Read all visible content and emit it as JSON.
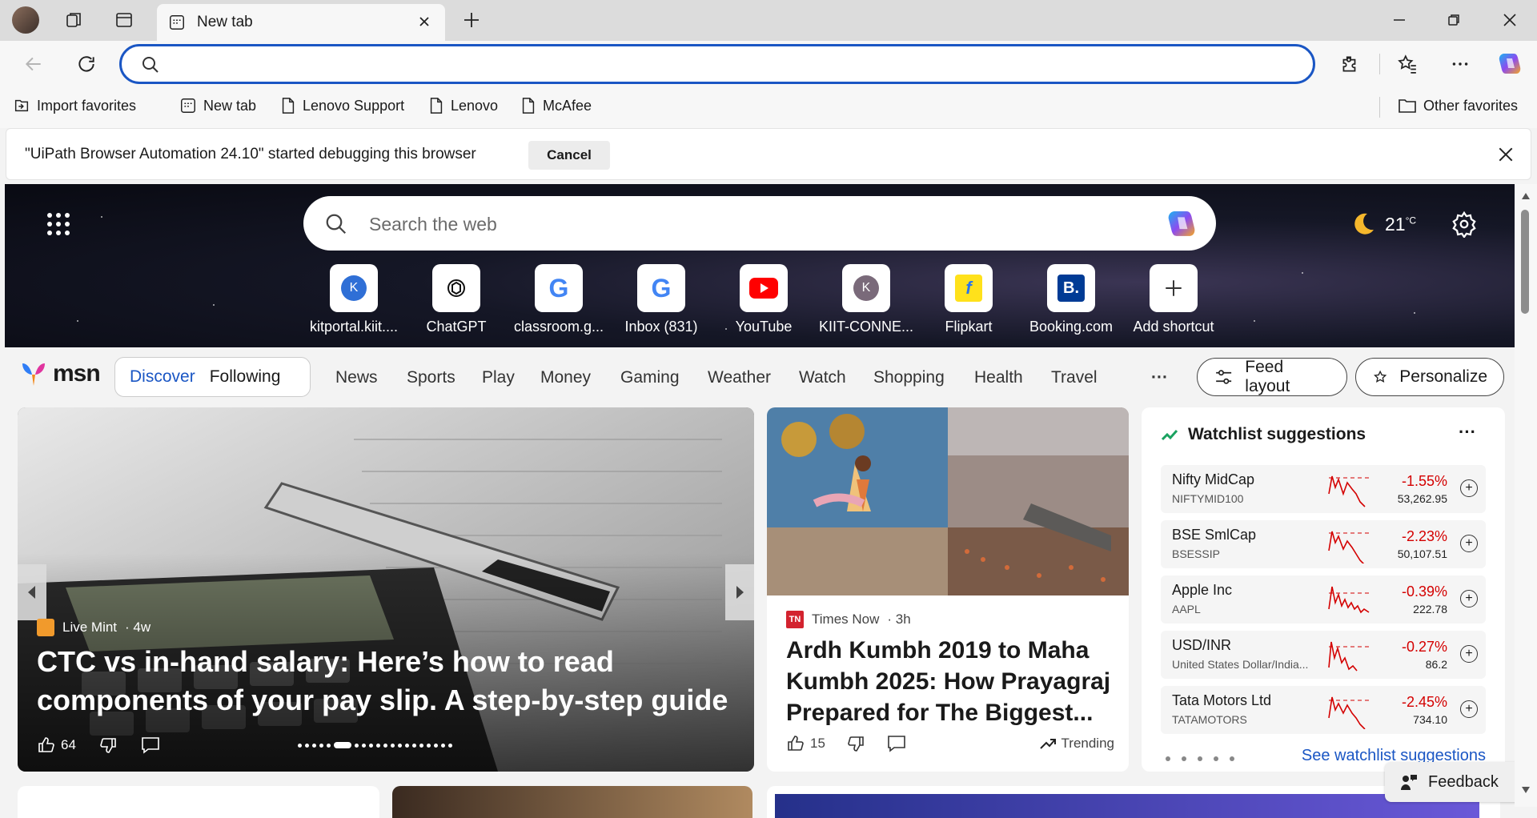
{
  "titlebar": {
    "tab_title": "New tab",
    "new_tab_symbol": "+"
  },
  "toolbar": {
    "address_value": "",
    "address_placeholder": ""
  },
  "favorites": {
    "items": [
      {
        "label": "Import favorites",
        "icon": "import-icon"
      },
      {
        "label": "New tab",
        "icon": "newtab-icon"
      },
      {
        "label": "Lenovo Support",
        "icon": "page-icon"
      },
      {
        "label": "Lenovo",
        "icon": "page-icon"
      },
      {
        "label": "McAfee",
        "icon": "page-icon"
      }
    ],
    "other": "Other favorites"
  },
  "infobar": {
    "message": "\"UiPath Browser Automation 24.10\" started debugging this browser",
    "cancel": "Cancel"
  },
  "hero": {
    "search_placeholder": "Search the web",
    "temperature": "21",
    "unit": "°C",
    "shortcuts": [
      {
        "label": "kitportal.kiit....",
        "icon": "k-avatar-icon"
      },
      {
        "label": "ChatGPT",
        "icon": "chatgpt-icon"
      },
      {
        "label": "classroom.g...",
        "icon": "google-icon"
      },
      {
        "label": "Inbox (831)",
        "icon": "google-icon"
      },
      {
        "label": "YouTube",
        "icon": "youtube-icon"
      },
      {
        "label": "KIIT-CONNE...",
        "icon": "k-avatar-icon"
      },
      {
        "label": "Flipkart",
        "icon": "flipkart-icon"
      },
      {
        "label": "Booking.com",
        "icon": "booking-icon"
      },
      {
        "label": "Add shortcut",
        "icon": "plus-icon"
      }
    ]
  },
  "nav": {
    "logo": "msn",
    "discover": "Discover",
    "following": "Following",
    "links": [
      "News",
      "Sports",
      "Play",
      "Money",
      "Gaming",
      "Weather",
      "Watch",
      "Shopping",
      "Health",
      "Travel"
    ],
    "more": "···",
    "feed_layout": "Feed layout",
    "personalize": "Personalize"
  },
  "bigcard": {
    "source": "Live Mint",
    "age": "· 4w",
    "title": "CTC vs in-hand salary: Here’s how to read components of your pay slip. A step-by-step guide",
    "likes": "64"
  },
  "midcard": {
    "source": "Times Now",
    "age": "· 3h",
    "title": "Ardh Kumbh 2019 to Maha Kumbh 2025: How Prayagraj Prepared for The Biggest...",
    "likes": "15",
    "trending": "Trending"
  },
  "watchlist": {
    "title": "Watchlist suggestions",
    "more": "···",
    "rows": [
      {
        "name": "Nifty MidCap",
        "symbol": "NIFTYMID100",
        "change": "-1.55%",
        "value": "53,262.95"
      },
      {
        "name": "BSE SmlCap",
        "symbol": "BSESSIP",
        "change": "-2.23%",
        "value": "50,107.51"
      },
      {
        "name": "Apple Inc",
        "symbol": "AAPL",
        "change": "-0.39%",
        "value": "222.78"
      },
      {
        "name": "USD/INR",
        "symbol": "United States Dollar/India...",
        "change": "-0.27%",
        "value": "86.2"
      },
      {
        "name": "Tata Motors Ltd",
        "symbol": "TATAMOTORS",
        "change": "-2.45%",
        "value": "734.10"
      }
    ],
    "see_all": "See watchlist suggestions"
  },
  "feedback": "Feedback",
  "colors": {
    "accent": "#1a56c4",
    "negative": "#d40000"
  }
}
